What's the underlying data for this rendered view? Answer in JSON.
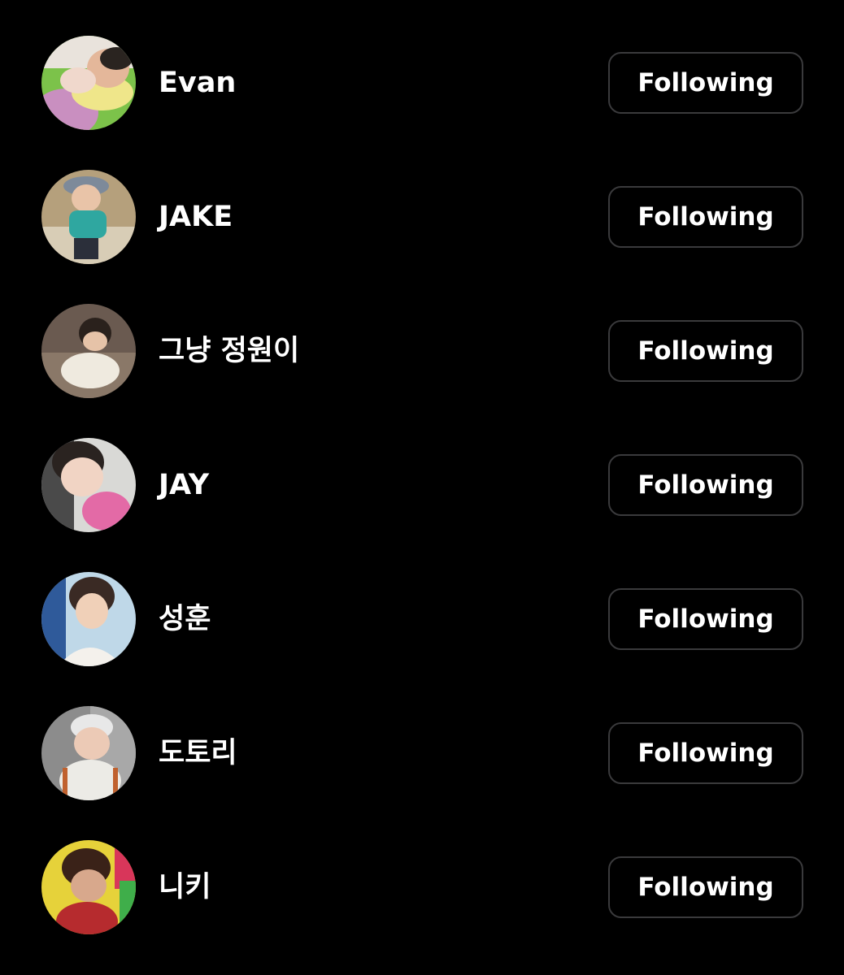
{
  "following_list": {
    "rows": [
      {
        "username": "Evan",
        "button_label": "Following",
        "avatar": "toddler-sleeping-photo"
      },
      {
        "username": "JAKE",
        "button_label": "Following",
        "avatar": "toddler-bucket-hat-photo"
      },
      {
        "username": "그냥 정원이",
        "button_label": "Following",
        "avatar": "toddler-sitting-photo"
      },
      {
        "username": "JAY",
        "button_label": "Following",
        "avatar": "toddler-car-seat-photo"
      },
      {
        "username": "성훈",
        "button_label": "Following",
        "avatar": "boy-portrait-photo"
      },
      {
        "username": "도토리",
        "button_label": "Following",
        "avatar": "toddler-white-cap-photo"
      },
      {
        "username": "니키",
        "button_label": "Following",
        "avatar": "child-red-shirt-photo"
      }
    ]
  },
  "colors": {
    "background": "#000000",
    "text": "#ffffff",
    "button_border": "#3a3a3c"
  }
}
